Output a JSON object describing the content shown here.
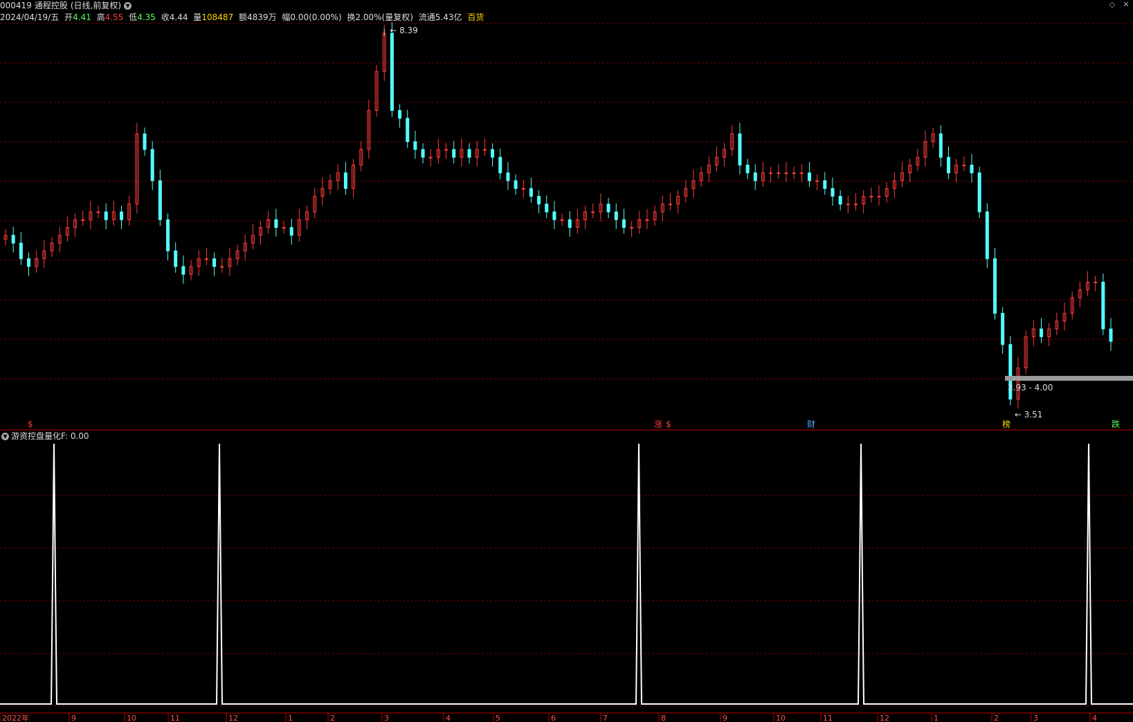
{
  "header": {
    "code": "000419",
    "name": "通程控股",
    "mode": "(日线,前复权)",
    "date": "2024/04/19/五",
    "open_label": "开",
    "open": "4.41",
    "high_label": "高",
    "high": "4.55",
    "low_label": "低",
    "low": "4.35",
    "close_label": "收",
    "close": "4.44",
    "vol_label": "量",
    "vol": "108487",
    "amount_label": "额",
    "amount": "4839万",
    "amp_label": "幅",
    "amp": "0.00(0.00%)",
    "turn_label": "换",
    "turn": "2.00%(量复权)",
    "float_label": "流通",
    "float": "5.43亿",
    "sector": "百货"
  },
  "indicator": {
    "title": "游资控盘量化F",
    "value": ": 0.00"
  },
  "annotations": {
    "peak": "8.39",
    "bottom": "3.51",
    "range": "3.93 - 4.00",
    "marks": [
      "$",
      "涨",
      "$",
      "财",
      "榜",
      "跌"
    ]
  },
  "colors": {
    "up": "#ff3c3c",
    "down": "#54ffff",
    "grid": "#7a0000",
    "axis": "#c00000",
    "indicator": "#ffffff"
  },
  "chart_data": [
    {
      "type": "candlestick",
      "title": "",
      "y_range": [
        3.51,
        8.39
      ],
      "x_labels": [
        "2022年",
        "9",
        "10",
        "11",
        "12",
        "1",
        "2",
        "3",
        "4",
        "5",
        "6",
        "7",
        "8",
        "9",
        "10",
        "11",
        "12",
        "1",
        "2",
        "3",
        "4"
      ],
      "close_approx": [
        5.8,
        5.7,
        5.5,
        5.4,
        5.5,
        5.6,
        5.7,
        5.8,
        5.9,
        6.0,
        6.0,
        6.1,
        6.1,
        6.0,
        6.1,
        6.0,
        6.2,
        7.1,
        6.9,
        6.5,
        6.0,
        5.6,
        5.4,
        5.3,
        5.4,
        5.5,
        5.5,
        5.4,
        5.4,
        5.5,
        5.6,
        5.7,
        5.8,
        5.9,
        6.0,
        5.9,
        5.9,
        5.8,
        6.0,
        6.1,
        6.3,
        6.4,
        6.5,
        6.6,
        6.4,
        6.7,
        6.9,
        7.4,
        7.9,
        8.39,
        7.4,
        7.3,
        7.0,
        6.9,
        6.8,
        6.8,
        6.9,
        6.9,
        6.8,
        6.9,
        6.8,
        6.9,
        6.9,
        6.8,
        6.6,
        6.5,
        6.4,
        6.4,
        6.3,
        6.2,
        6.1,
        6.0,
        6.0,
        5.9,
        6.0,
        6.1,
        6.1,
        6.2,
        6.1,
        6.0,
        5.9,
        5.9,
        6.0,
        6.0,
        6.1,
        6.2,
        6.2,
        6.3,
        6.4,
        6.5,
        6.6,
        6.7,
        6.8,
        6.9,
        7.1,
        6.7,
        6.6,
        6.5,
        6.6,
        6.6,
        6.6,
        6.6,
        6.6,
        6.6,
        6.5,
        6.5,
        6.4,
        6.3,
        6.2,
        6.2,
        6.2,
        6.3,
        6.3,
        6.3,
        6.4,
        6.5,
        6.6,
        6.7,
        6.8,
        7.0,
        7.1,
        6.8,
        6.6,
        6.7,
        6.7,
        6.6,
        6.1,
        5.5,
        4.8,
        4.4,
        3.7,
        4.1,
        4.5,
        4.6,
        4.5,
        4.6,
        4.7,
        4.8,
        5.0,
        5.1,
        5.2,
        5.2,
        4.6,
        4.44
      ]
    },
    {
      "type": "line",
      "title": "游资控盘量化F",
      "y_range": [
        0,
        1
      ],
      "x_labels": [
        "2022年",
        "9",
        "10",
        "11",
        "12",
        "1",
        "2",
        "3",
        "4",
        "5",
        "6",
        "7",
        "8",
        "9",
        "10",
        "11",
        "12",
        "1",
        "2",
        "3",
        "4"
      ],
      "spike_positions": [
        "9",
        "12",
        "8",
        "12",
        "4"
      ],
      "values_note": "",
      "baseline": 0,
      "peak": 1
    }
  ]
}
